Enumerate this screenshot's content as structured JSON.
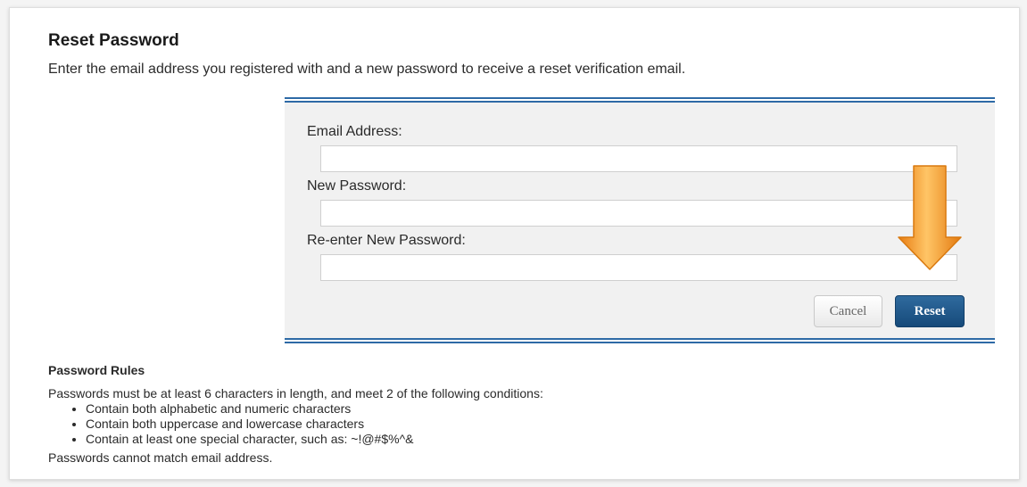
{
  "page": {
    "title": "Reset Password",
    "subtitle": "Enter the email address you registered with and a new password to receive a reset verification email."
  },
  "form": {
    "email_label": "Email Address:",
    "email_value": "",
    "new_password_label": "New Password:",
    "new_password_value": "",
    "reenter_password_label": "Re-enter New Password:",
    "reenter_password_value": "",
    "cancel_label": "Cancel",
    "reset_label": "Reset"
  },
  "rules": {
    "title": "Password Rules",
    "intro": "Passwords must be at least 6 characters in length, and meet 2 of the following conditions:",
    "items": [
      "Contain both alphabetic and numeric characters",
      "Contain both uppercase and lowercase characters",
      "Contain at least one special character, such as: ~!@#$%^&"
    ],
    "footer": "Passwords cannot match email address."
  },
  "annotation": {
    "icon": "down-arrow-icon",
    "color": "#f29423"
  },
  "colors": {
    "accent": "#2e6aa6",
    "reset_button": "#1f5588"
  }
}
